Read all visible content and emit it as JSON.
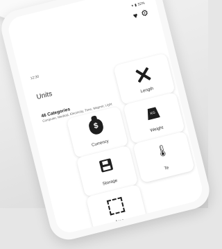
{
  "status": {
    "time": "12:30",
    "battery": "52%"
  },
  "header": {
    "heart_icon": "heart-icon",
    "settings_icon": "gear-icon"
  },
  "main": {
    "title": "Units",
    "count": "46 Categories",
    "categories_line": "Computer, Medical, Electricity, Time, Magnet, Light"
  },
  "cards": {
    "length": "Length",
    "currency": "Currency",
    "weight": "Weight",
    "storage": "Storage",
    "temperature": "Te",
    "area": "Area",
    "weight_badge": "KG",
    "currency_symbol": "$"
  }
}
